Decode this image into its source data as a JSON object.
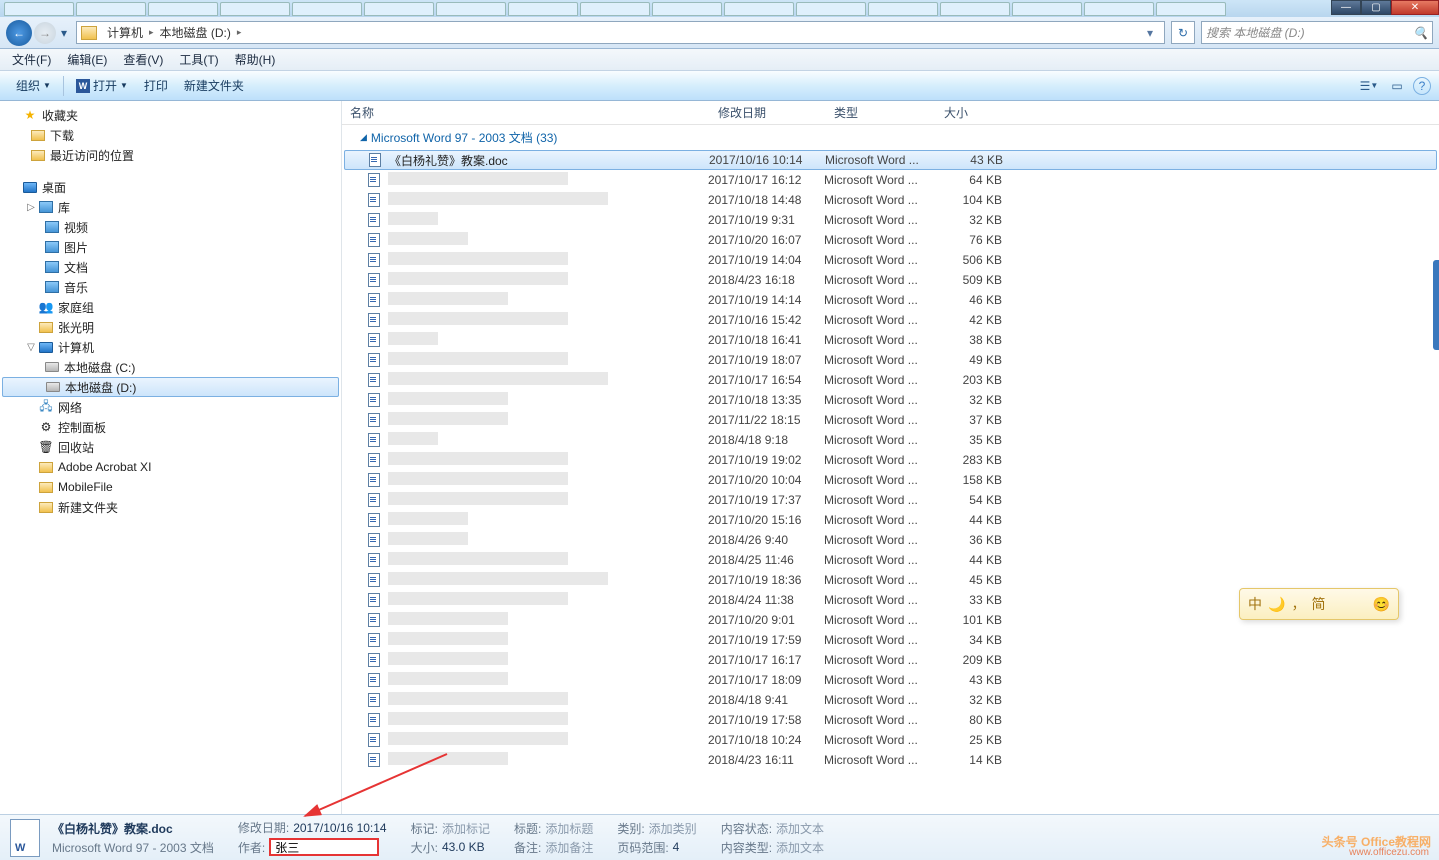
{
  "window": {
    "min": "—",
    "max": "▢",
    "close": "✕"
  },
  "nav": {
    "back": "←",
    "fwd": "→",
    "dd": "▾"
  },
  "breadcrumbs": {
    "root": "计算机",
    "drive": "本地磁盘 (D:)",
    "sep": "▸",
    "final_sep": "▸"
  },
  "addressbar": {
    "dd": "▾",
    "refresh": "↻"
  },
  "search": {
    "placeholder": "搜索 本地磁盘 (D:)",
    "icon": "🔍"
  },
  "menu": {
    "file": "文件(F)",
    "edit": "编辑(E)",
    "view": "查看(V)",
    "tools": "工具(T)",
    "help": "帮助(H)"
  },
  "toolbar": {
    "organize": "组织",
    "open": "打开",
    "print": "打印",
    "new_folder": "新建文件夹",
    "dd": "▼",
    "view_icon": "☰",
    "preview_icon": "▭",
    "help_icon": "?"
  },
  "tree": {
    "favorites": "收藏夹",
    "downloads": "下载",
    "recent": "最近访问的位置",
    "desktop": "桌面",
    "libraries": "库",
    "videos": "视频",
    "pictures": "图片",
    "documents": "文档",
    "music": "音乐",
    "homegroup": "家庭组",
    "user": "张光明",
    "computer": "计算机",
    "drive_c": "本地磁盘 (C:)",
    "drive_d": "本地磁盘 (D:)",
    "network": "网络",
    "control_panel": "控制面板",
    "recycle": "回收站",
    "adobe": "Adobe Acrobat XI",
    "mobile": "MobileFile",
    "newfolder": "新建文件夹"
  },
  "columns": {
    "name": "名称",
    "date": "修改日期",
    "type": "类型",
    "size": "大小"
  },
  "group": {
    "label": "Microsoft Word 97 - 2003 文档 (33)",
    "tri": "◢"
  },
  "word_type": "Microsoft Word ...",
  "rows": [
    {
      "name": "《白杨礼赞》教案.doc",
      "date": "2017/10/16 10:14",
      "size": "43 KB",
      "sel": true,
      "clear": true,
      "bw": 0
    },
    {
      "name": "",
      "date": "2017/10/17 16:12",
      "size": "64 KB",
      "bw": 3
    },
    {
      "name": "",
      "date": "2017/10/18 14:48",
      "size": "104 KB",
      "bw": 5
    },
    {
      "name": "",
      "date": "2017/10/19 9:31",
      "size": "32 KB",
      "bw": 1
    },
    {
      "name": "",
      "date": "2017/10/20 16:07",
      "size": "76 KB",
      "bw": 4
    },
    {
      "name": "",
      "date": "2017/10/19 14:04",
      "size": "506 KB",
      "bw": 3
    },
    {
      "name": "",
      "date": "2018/4/23 16:18",
      "size": "509 KB",
      "bw": 3
    },
    {
      "name": "",
      "date": "2017/10/19 14:14",
      "size": "46 KB",
      "bw": 2
    },
    {
      "name": "",
      "date": "2017/10/16 15:42",
      "size": "42 KB",
      "bw": 3
    },
    {
      "name": "",
      "date": "2017/10/18 16:41",
      "size": "38 KB",
      "bw": 1
    },
    {
      "name": "",
      "date": "2017/10/19 18:07",
      "size": "49 KB",
      "bw": 3
    },
    {
      "name": "",
      "date": "2017/10/17 16:54",
      "size": "203 KB",
      "bw": 5
    },
    {
      "name": "",
      "date": "2017/10/18 13:35",
      "size": "32 KB",
      "bw": 2
    },
    {
      "name": "",
      "date": "2017/11/22 18:15",
      "size": "37 KB",
      "bw": 2
    },
    {
      "name": "",
      "date": "2018/4/18 9:18",
      "size": "35 KB",
      "bw": 1
    },
    {
      "name": "",
      "date": "2017/10/19 19:02",
      "size": "283 KB",
      "bw": 3
    },
    {
      "name": "",
      "date": "2017/10/20 10:04",
      "size": "158 KB",
      "bw": 3
    },
    {
      "name": "",
      "date": "2017/10/19 17:37",
      "size": "54 KB",
      "bw": 3
    },
    {
      "name": "",
      "date": "2017/10/20 15:16",
      "size": "44 KB",
      "bw": 4
    },
    {
      "name": "",
      "date": "2018/4/26 9:40",
      "size": "36 KB",
      "bw": 4
    },
    {
      "name": "",
      "date": "2018/4/25 11:46",
      "size": "44 KB",
      "bw": 3
    },
    {
      "name": "",
      "date": "2017/10/19 18:36",
      "size": "45 KB",
      "bw": 5
    },
    {
      "name": "",
      "date": "2018/4/24 11:38",
      "size": "33 KB",
      "bw": 3
    },
    {
      "name": "",
      "date": "2017/10/20 9:01",
      "size": "101 KB",
      "bw": 2
    },
    {
      "name": "",
      "date": "2017/10/19 17:59",
      "size": "34 KB",
      "bw": 2
    },
    {
      "name": "",
      "date": "2017/10/17 16:17",
      "size": "209 KB",
      "bw": 2
    },
    {
      "name": "",
      "date": "2017/10/17 18:09",
      "size": "43 KB",
      "bw": 2
    },
    {
      "name": "",
      "date": "2018/4/18 9:41",
      "size": "32 KB",
      "bw": 3
    },
    {
      "name": "",
      "date": "2017/10/19 17:58",
      "size": "80 KB",
      "bw": 3
    },
    {
      "name": "",
      "date": "2017/10/18 10:24",
      "size": "25 KB",
      "bw": 3
    },
    {
      "name": "",
      "date": "2018/4/23 16:11",
      "size": "14 KB",
      "bw": 2
    }
  ],
  "details": {
    "filename": "《白杨礼赞》教案.doc",
    "filetype": "Microsoft Word 97 - 2003 文档",
    "date_label": "修改日期:",
    "date_val": "2017/10/16 10:14",
    "author_label": "作者:",
    "author_val": "张三",
    "tags_label": "标记:",
    "tags_val": "添加标记",
    "size_label": "大小:",
    "size_val": "43.0 KB",
    "title_label": "标题:",
    "title_val": "添加标题",
    "notes_label": "备注:",
    "notes_val": "添加备注",
    "category_label": "类别:",
    "category_val": "添加类别",
    "pages_label": "页码范围:",
    "pages_val": "4",
    "status_label": "内容状态:",
    "status_val": "添加文本",
    "ctype_label": "内容类型:",
    "ctype_val": "添加文本"
  },
  "ime": {
    "lang": "中",
    "moon": "🌙",
    "other": "，",
    "mode": "简",
    "smile": "😊"
  },
  "watermark": {
    "text": "头条号 Office教程网",
    "sub": "www.officezu.com"
  }
}
